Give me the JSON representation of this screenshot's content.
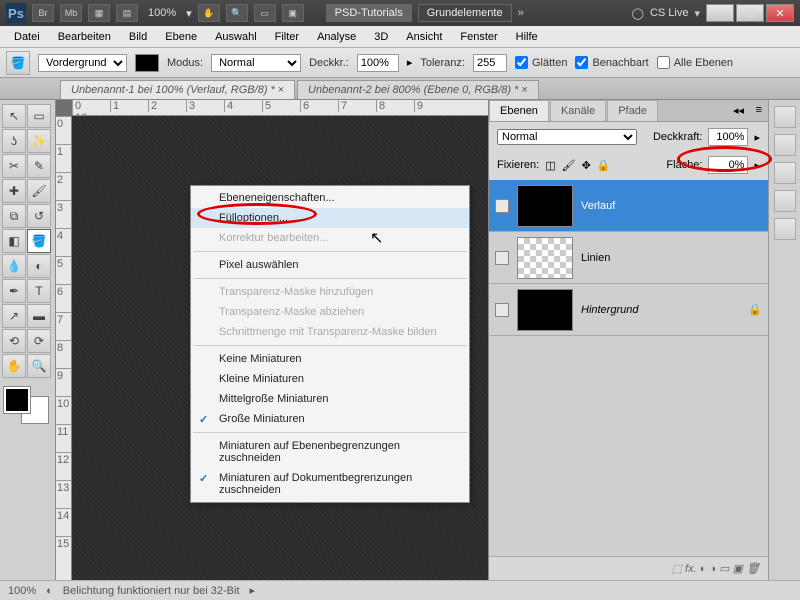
{
  "titlebar": {
    "ps": "Ps",
    "br": "Br",
    "mb": "Mb",
    "zoom": "100%",
    "group_a": "PSD-Tutorials",
    "group_b": "Grundelemente",
    "cslive": "CS Live"
  },
  "menubar": [
    "Datei",
    "Bearbeiten",
    "Bild",
    "Ebene",
    "Auswahl",
    "Filter",
    "Analyse",
    "3D",
    "Ansicht",
    "Fenster",
    "Hilfe"
  ],
  "optbar": {
    "fg_label": "Vordergrund",
    "mode_label": "Modus:",
    "mode_value": "Normal",
    "opacity_label": "Deckkr.:",
    "opacity_value": "100%",
    "tol_label": "Toleranz:",
    "tol_value": "255",
    "glatten": "Glätten",
    "benachbart": "Benachbart",
    "alle_ebenen": "Alle Ebenen"
  },
  "tabs": {
    "a": "Unbenannt-1 bei 100% (Verlauf, RGB/8) *",
    "b": "Unbenannt-2 bei 800% (Ebene 0, RGB/8) *"
  },
  "panels": {
    "tabs": {
      "ebenen": "Ebenen",
      "kanale": "Kanäle",
      "pfade": "Pfade"
    },
    "blend": "Normal",
    "deckkraft_label": "Deckkraft:",
    "deckkraft_value": "100%",
    "fix_label": "Fixieren:",
    "flache_label": "Fläche:",
    "flache_value": "0%"
  },
  "layers": {
    "l1": "Verlauf",
    "l2": "Linien",
    "l3": "Hintergrund"
  },
  "layer_footer_icons": "⬚  fx.  ◐  ◑  ▭  ▣  🗑",
  "context": {
    "props": "Ebeneneigenschaften...",
    "full": "Fülloptionen...",
    "korr": "Korrektur bearbeiten...",
    "pixel": "Pixel auswählen",
    "tmh": "Transparenz-Maske hinzufügen",
    "tma": "Transparenz-Maske abziehen",
    "schn": "Schnittmenge mit Transparenz-Maske bilden",
    "keine": "Keine Miniaturen",
    "kleine": "Kleine Miniaturen",
    "mittel": "Mittelgroße Miniaturen",
    "grosse": "Große Miniaturen",
    "min_eb": "Miniaturen auf Ebenenbegrenzungen zuschneiden",
    "min_dok": "Miniaturen auf Dokumentbegrenzungen zuschneiden"
  },
  "status": {
    "zoom": "100%",
    "msg": "Belichtung funktioniert nur bei 32-Bit"
  }
}
